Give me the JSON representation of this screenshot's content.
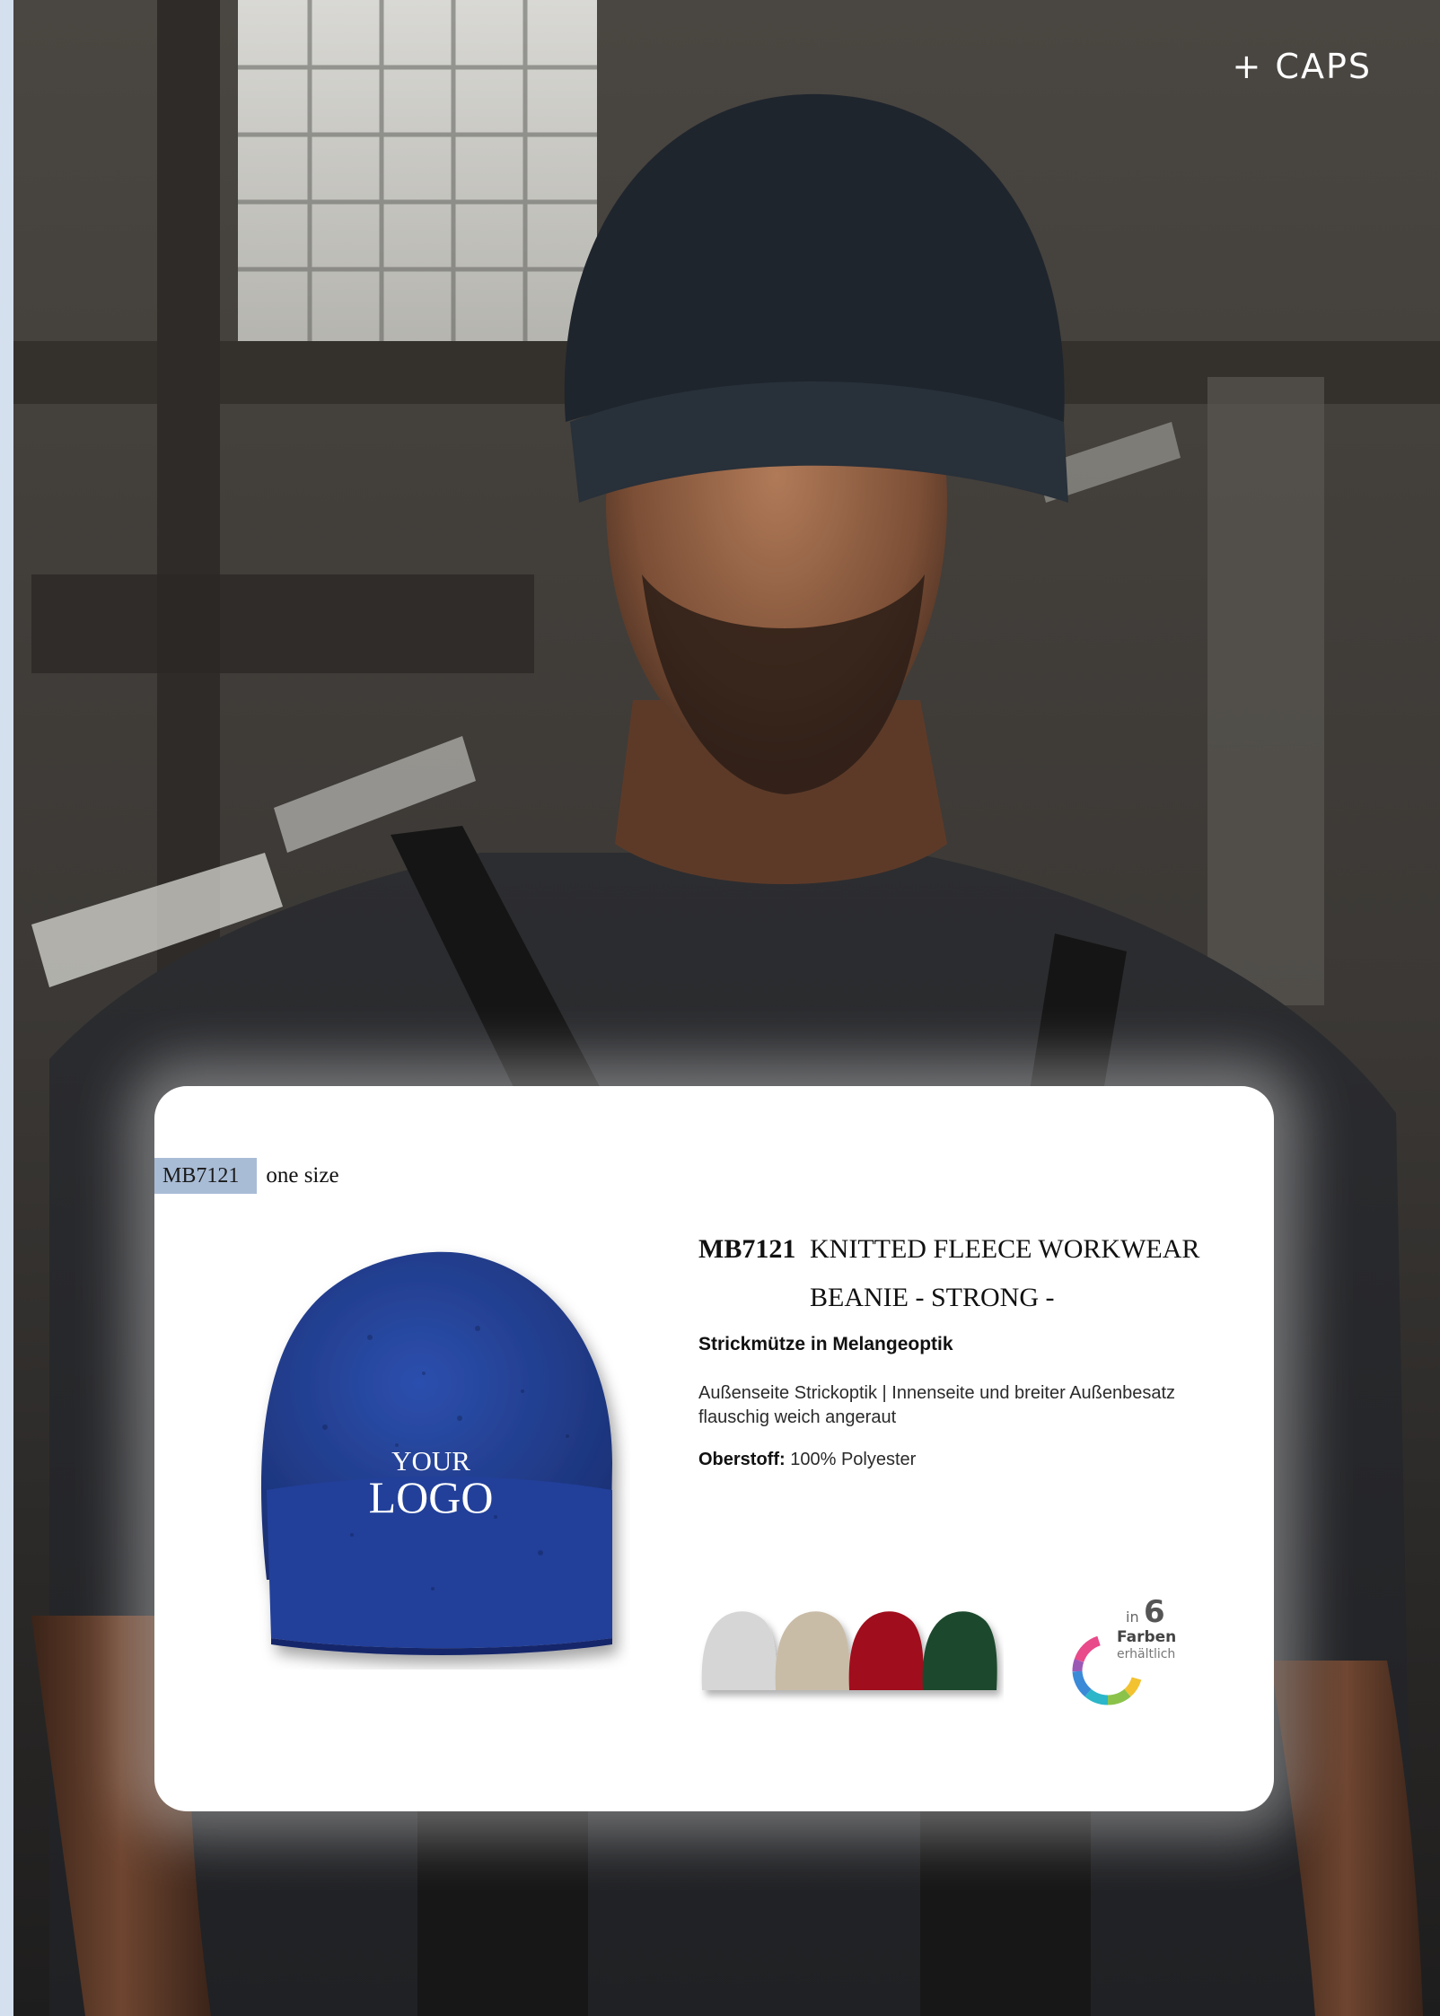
{
  "section": {
    "label": "+ CAPS"
  },
  "product": {
    "sku_tag": "MB7121",
    "size": "one size",
    "code": "MB7121",
    "title_line1": "KNITTED FLEECE WORKWEAR",
    "title_line2": "BEANIE - STRONG -",
    "subtitle": "Strickmütze in Melangeoptik",
    "description": "Außenseite Strickoptik | Innenseite und breiter Außenbesatz flauschig weich angeraut",
    "material_label": "Oberstoff:",
    "material_value": "100% Polyester",
    "image_logo_line1": "YOUR",
    "image_logo_line2": "LOGO"
  },
  "color_variants": [
    {
      "name": "grey",
      "color": "#d6d6d6"
    },
    {
      "name": "beige",
      "color": "#c9bca7"
    },
    {
      "name": "red",
      "color": "#a0101d"
    },
    {
      "name": "green",
      "color": "#1f4a2e"
    }
  ],
  "main_color": "#24439a",
  "colors_badge": {
    "prefix": "in",
    "count": "6",
    "line1": "Farben",
    "line2": "erhältlich"
  },
  "palette": {
    "left_strip": "#d5e0ee",
    "sku_tag_bg": "#a9bcd6"
  }
}
